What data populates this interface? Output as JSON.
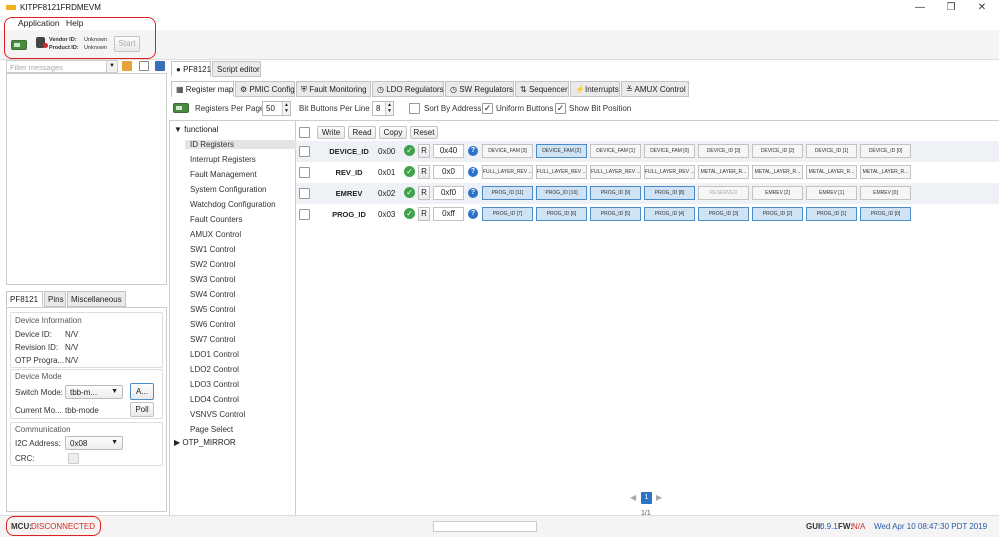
{
  "window": {
    "title": "KITPF8121FRDMEVM",
    "min": "—",
    "restore": "❐",
    "close": "✕"
  },
  "menu": [
    "Application",
    "Help"
  ],
  "toolbar": {
    "vendor_label": "Vendor ID:",
    "vendor_value": "Unknown",
    "product_label": "Product ID:",
    "product_value": "Unknown",
    "start_label": "Start"
  },
  "left": {
    "filter_placeholder": "Filter messages",
    "tabs": [
      "PF8121",
      "Pins",
      "Miscellaneous"
    ],
    "device_info": {
      "header": "Device Information",
      "rows": [
        {
          "label": "Device ID:",
          "value": "N/V"
        },
        {
          "label": "Revision ID:",
          "value": "N/V"
        },
        {
          "label": "OTP Progra...",
          "value": "N/V"
        }
      ]
    },
    "device_mode": {
      "header": "Device Mode",
      "switch_label": "Switch Mode:",
      "switch_value": "tbb-m...",
      "apply_label": "A...",
      "current_label": "Current Mo...",
      "current_value": "tbb-mode",
      "poll_label": "Poll"
    },
    "communication": {
      "header": "Communication",
      "i2c_label": "I2C Address:",
      "i2c_value": "0x08",
      "crc_label": "CRC:"
    }
  },
  "status": {
    "mcu_label": "MCU:",
    "mcu_value": "DISCONNECTED",
    "gui_label": "GUI:",
    "gui_value": "0.9.1",
    "fw_label": "FW:",
    "fw_value": "N/A",
    "datetime": "Wed Apr 10 08:47:30 PDT 2019"
  },
  "main": {
    "tabs": [
      "PF8121",
      "Script editor"
    ],
    "subtabs": [
      "Register map",
      "PMIC Config",
      "Fault Monitoring",
      "LDO Regulators",
      "SW Regulators",
      "Sequencer",
      "Interrupts",
      "AMUX Control"
    ],
    "options": {
      "rpp_label": "Registers Per Page",
      "rpp_value": "50",
      "bbpl_label": "Bit Buttons Per Line",
      "bbpl_value": "8",
      "sort_label": "Sort By Address",
      "uniform_label": "Uniform Buttons",
      "showbit_label": "Show Bit Position"
    },
    "tree": {
      "group": "functional",
      "items": [
        "ID Registers",
        "Interrupt Registers",
        "Fault Management",
        "System Configuration",
        "Watchdog Configuration",
        "Fault Counters",
        "AMUX Control",
        "SW1 Control",
        "SW2 Control",
        "SW3 Control",
        "SW4 Control",
        "SW5 Control",
        "SW6 Control",
        "SW7 Control",
        "LDO1 Control",
        "LDO2 Control",
        "LDO3 Control",
        "LDO4 Control",
        "VSNVS Control",
        "Page Select"
      ],
      "group2": "OTP_MIRROR"
    },
    "grid_buttons": [
      "Write",
      "Read",
      "Copy",
      "Reset"
    ],
    "registers": [
      {
        "name": "DEVICE_ID",
        "addr": "0x00",
        "r": "R",
        "value": "0x40",
        "bits": [
          "DEVICE_FAM [3]",
          "DEVICE_FAM [2]",
          "DEVICE_FAM [1]",
          "DEVICE_FAM [0]",
          "DEVICE_ID [3]",
          "DEVICE_ID [2]",
          "DEVICE_ID [1]",
          "DEVICE_ID [0]"
        ],
        "on": [
          false,
          true,
          false,
          false,
          false,
          false,
          false,
          false
        ]
      },
      {
        "name": "REV_ID",
        "addr": "0x01",
        "r": "R",
        "value": "0x0",
        "bits": [
          "FULL_LAYER_REV ...",
          "FULL_LAYER_REV ...",
          "FULL_LAYER_REV ...",
          "FULL_LAYER_REV ...",
          "METAL_LAYER_R...",
          "METAL_LAYER_R...",
          "METAL_LAYER_R...",
          "METAL_LAYER_R..."
        ],
        "on": [
          false,
          false,
          false,
          false,
          false,
          false,
          false,
          false
        ]
      },
      {
        "name": "EMREV",
        "addr": "0x02",
        "r": "R",
        "value": "0xf0",
        "bits": [
          "PROG_ID [11]",
          "PROG_ID [10]",
          "PROG_ID [9]",
          "PROG_ID [8]",
          "RESERVED",
          "EMREV [2]",
          "EMREV [1]",
          "EMREV [0]"
        ],
        "on": [
          true,
          true,
          true,
          true,
          false,
          false,
          false,
          false
        ]
      },
      {
        "name": "PROG_ID",
        "addr": "0x03",
        "r": "R",
        "value": "0xff",
        "bits": [
          "PROG_ID [7]",
          "PROG_ID [6]",
          "PROG_ID [5]",
          "PROG_ID [4]",
          "PROG_ID [3]",
          "PROG_ID [2]",
          "PROG_ID [1]",
          "PROG_ID [0]"
        ],
        "on": [
          true,
          true,
          true,
          true,
          true,
          true,
          true,
          true
        ]
      }
    ],
    "pager": {
      "page": "1",
      "of": "1/1"
    }
  }
}
